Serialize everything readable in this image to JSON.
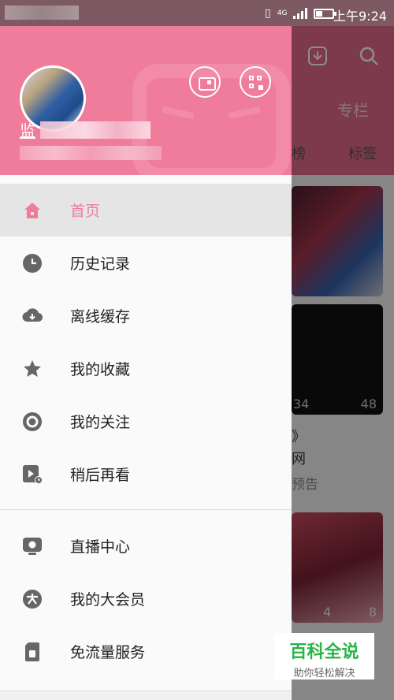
{
  "status_bar": {
    "time": "上午9:24",
    "network": "4G"
  },
  "background_app": {
    "tab_label": "专栏",
    "chip_rank": "榜",
    "chip_tag": "标签",
    "card_text_1": "》",
    "card_text_2": "网",
    "card_text_3": "预告",
    "card_counts": [
      "34",
      "48",
      "4",
      "8"
    ]
  },
  "drawer": {
    "user": {
      "name_prefix": "监"
    },
    "header_buttons": [
      "wallet-icon",
      "qr-code-icon"
    ],
    "menu_items": [
      {
        "label": "首页",
        "icon": "home-icon",
        "active": true
      },
      {
        "label": "历史记录",
        "icon": "clock-icon"
      },
      {
        "label": "离线缓存",
        "icon": "cloud-download-icon"
      },
      {
        "label": "我的收藏",
        "icon": "star-icon"
      },
      {
        "label": "我的关注",
        "icon": "follow-icon"
      },
      {
        "label": "稍后再看",
        "icon": "watch-later-icon"
      }
    ],
    "menu_items_2": [
      {
        "label": "直播中心",
        "icon": "live-tv-icon"
      },
      {
        "label": "我的大会员",
        "icon": "vip-icon"
      },
      {
        "label": "免流量服务",
        "icon": "sim-card-icon"
      }
    ]
  },
  "watermark": {
    "title": "百科全说",
    "subtitle": "助你轻松解决"
  },
  "colors": {
    "accent": "#f07c9b",
    "icon_gray": "#666666",
    "watermark_green": "#28b446"
  }
}
